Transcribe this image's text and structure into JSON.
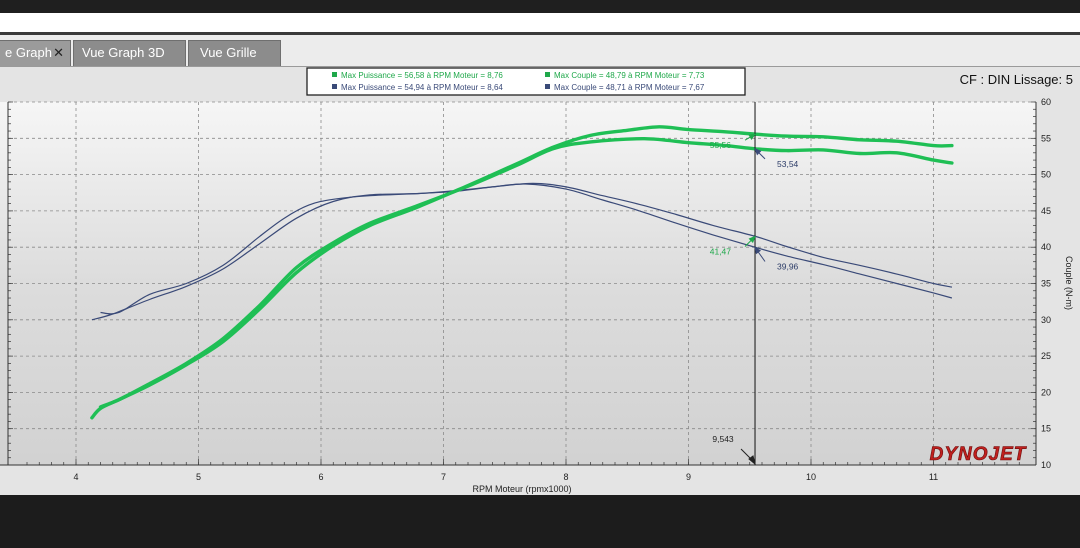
{
  "tabs": [
    {
      "label": "e Graph",
      "active": true,
      "closable": true
    },
    {
      "label": "Vue Graph 3D",
      "active": false
    },
    {
      "label": "Vue Grille",
      "active": false
    }
  ],
  "cf_label": "CF : DIN Lissage: 5",
  "legend": [
    {
      "text": "Max Puissance = 56,58 à RPM Moteur = 8,76",
      "color": "#1fa84a"
    },
    {
      "text": "Max Couple = 48,79 à RPM Moteur = 7,73",
      "color": "#1fa84a"
    },
    {
      "text": "Max Puissance = 54,94 à RPM Moteur = 8,64",
      "color": "#3a4a78"
    },
    {
      "text": "Max Couple = 48,71 à RPM Moteur = 7,67",
      "color": "#3a4a78"
    }
  ],
  "brand": "DYNOJET",
  "colors": {
    "green": "#1fbf55",
    "blue": "#3a4a78",
    "brand_red": "#c0201e"
  },
  "chart_data": {
    "type": "line",
    "xlabel": "RPM Moteur (rpmx1000)",
    "ylabel_right": "Couple (N-m)",
    "xlim": [
      3.5,
      11.8
    ],
    "ylim": [
      10,
      60
    ],
    "x_ticks": [
      "4",
      "5",
      "6",
      "7",
      "8",
      "9",
      "10",
      "11"
    ],
    "y_ticks": [
      "10",
      "15",
      "20",
      "25",
      "30",
      "35",
      "40",
      "45",
      "50",
      "55",
      "60"
    ],
    "grid": true,
    "cursor": {
      "x": 9.543,
      "label": "9,543"
    },
    "cursor_values": [
      {
        "text": "55,56",
        "x": 9.5,
        "y": 55.56,
        "color": "green"
      },
      {
        "text": "53,54",
        "x": 9.5,
        "y": 53.54,
        "color": "blue"
      },
      {
        "text": "41,47",
        "x": 9.5,
        "y": 41.47,
        "color": "green"
      },
      {
        "text": "39,96",
        "x": 9.5,
        "y": 39.96,
        "color": "blue"
      }
    ],
    "series": [
      {
        "color": "green",
        "role": "puissance",
        "x": [
          4.13,
          4.2,
          4.35,
          4.6,
          4.9,
          5.2,
          5.5,
          5.8,
          6.1,
          6.4,
          6.8,
          7.2,
          7.6,
          7.9,
          8.2,
          8.5,
          8.76,
          9.0,
          9.3,
          9.55,
          9.8,
          10.1,
          10.4,
          10.7,
          11.0,
          11.15
        ],
        "y": [
          16.5,
          17.8,
          19.0,
          21.0,
          23.8,
          27.0,
          31.5,
          36.5,
          40.2,
          43.0,
          45.6,
          48.5,
          51.5,
          53.8,
          55.4,
          56.1,
          56.58,
          56.2,
          55.9,
          55.56,
          55.3,
          55.2,
          54.8,
          54.6,
          54.0,
          54.0
        ]
      },
      {
        "color": "blue",
        "role": "puissance",
        "x": [
          4.2,
          4.35,
          4.6,
          4.9,
          5.2,
          5.5,
          5.8,
          6.1,
          6.4,
          6.8,
          7.2,
          7.6,
          7.9,
          8.2,
          8.64,
          9.0,
          9.3,
          9.55,
          9.8,
          10.1,
          10.4,
          10.7,
          11.0,
          11.15
        ],
        "y": [
          18.0,
          19.0,
          21.2,
          24.0,
          27.4,
          32.0,
          37.2,
          40.6,
          43.3,
          45.8,
          48.4,
          51.3,
          53.6,
          54.5,
          54.94,
          54.4,
          54.0,
          53.54,
          53.3,
          53.4,
          52.9,
          53.0,
          52.0,
          51.6
        ]
      },
      {
        "color": "green",
        "role": "couple",
        "x": [
          4.13,
          4.3,
          4.6,
          4.9,
          5.2,
          5.5,
          5.8,
          6.1,
          6.4,
          6.8,
          7.1,
          7.4,
          7.73,
          8.0,
          8.3,
          8.6,
          8.9,
          9.2,
          9.55,
          9.8,
          10.1,
          10.4,
          10.7,
          11.0,
          11.15
        ],
        "y": [
          30.0,
          30.8,
          32.8,
          34.6,
          37.0,
          40.5,
          44.0,
          46.3,
          47.2,
          47.4,
          47.8,
          48.3,
          48.79,
          48.3,
          47.1,
          45.9,
          44.5,
          43.0,
          41.47,
          40.1,
          38.6,
          37.5,
          36.3,
          35.0,
          34.5
        ]
      },
      {
        "color": "blue",
        "role": "couple",
        "x": [
          4.2,
          4.35,
          4.6,
          4.9,
          5.2,
          5.5,
          5.7,
          5.9,
          6.1,
          6.4,
          6.8,
          7.1,
          7.4,
          7.67,
          8.0,
          8.3,
          8.6,
          8.9,
          9.2,
          9.55,
          9.8,
          10.1,
          10.4,
          10.7,
          11.0,
          11.15
        ],
        "y": [
          31.0,
          31.0,
          33.5,
          35.0,
          37.5,
          41.5,
          44.0,
          45.8,
          46.6,
          47.1,
          47.4,
          47.7,
          48.3,
          48.71,
          48.0,
          46.5,
          45.0,
          43.3,
          41.7,
          39.96,
          38.8,
          37.6,
          36.3,
          35.0,
          33.7,
          33.0
        ]
      }
    ]
  }
}
